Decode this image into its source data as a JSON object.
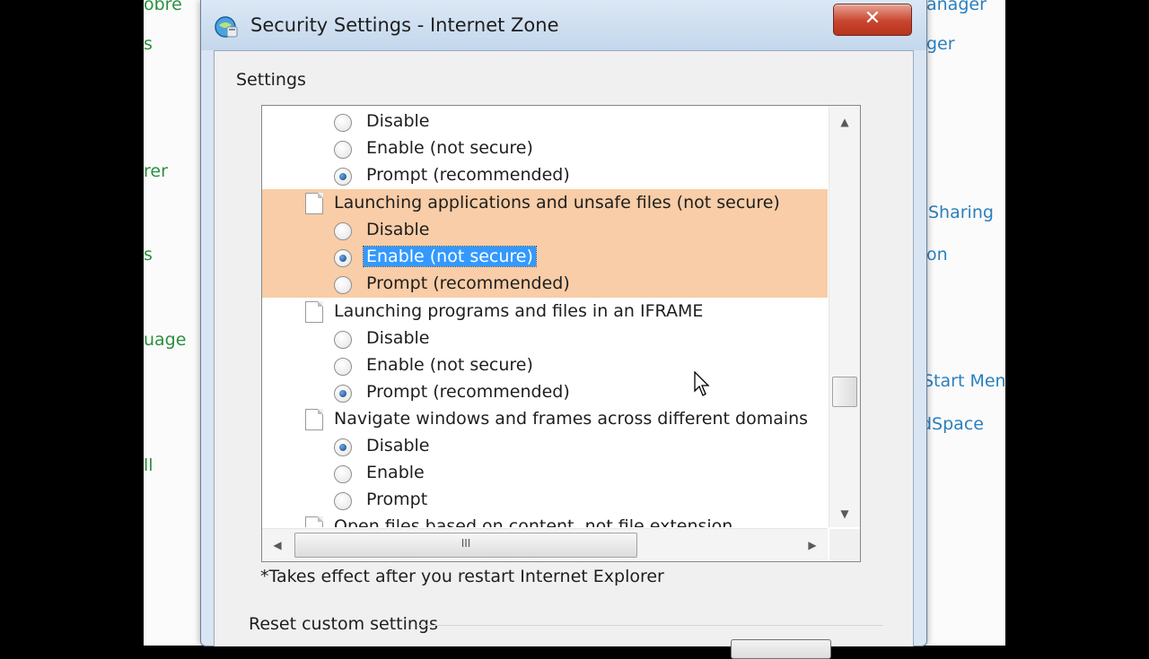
{
  "background": {
    "left_fragments": [
      "obre",
      "s",
      "rer",
      "s",
      "uage",
      "ll"
    ],
    "right_fragments": [
      "anager",
      "ger",
      "Sharing",
      "on",
      "Start Men",
      "dSpace"
    ]
  },
  "dialog": {
    "title": "Security Settings - Internet Zone",
    "close_glyph": "✕",
    "settings_label": "Settings",
    "list": {
      "rows": [
        {
          "type": "option",
          "label": "Disable",
          "checked": false
        },
        {
          "type": "option",
          "label": "Enable (not secure)",
          "checked": false
        },
        {
          "type": "option",
          "label": "Prompt (recommended)",
          "checked": true
        },
        {
          "type": "heading",
          "label": "Launching applications and unsafe files (not secure)"
        },
        {
          "type": "option",
          "label": "Disable",
          "checked": false
        },
        {
          "type": "option",
          "label": "Enable (not secure)",
          "checked": true,
          "selected": true
        },
        {
          "type": "option",
          "label": "Prompt (recommended)",
          "checked": false
        },
        {
          "type": "heading",
          "label": "Launching programs and files in an IFRAME"
        },
        {
          "type": "option",
          "label": "Disable",
          "checked": false
        },
        {
          "type": "option",
          "label": "Enable (not secure)",
          "checked": false
        },
        {
          "type": "option",
          "label": "Prompt (recommended)",
          "checked": true
        },
        {
          "type": "heading",
          "label": "Navigate windows and frames across different domains"
        },
        {
          "type": "option",
          "label": "Disable",
          "checked": true
        },
        {
          "type": "option",
          "label": "Enable",
          "checked": false
        },
        {
          "type": "option",
          "label": "Prompt",
          "checked": false
        },
        {
          "type": "heading",
          "label": "Open files based on content, not file extension"
        }
      ],
      "scroll_up_glyph": "▲",
      "scroll_down_glyph": "▼",
      "scroll_left_glyph": "◀",
      "scroll_right_glyph": "▶",
      "hthumb_grip": "III"
    },
    "footnote": "*Takes effect after you restart Internet Explorer",
    "reset_label": "Reset custom settings"
  }
}
